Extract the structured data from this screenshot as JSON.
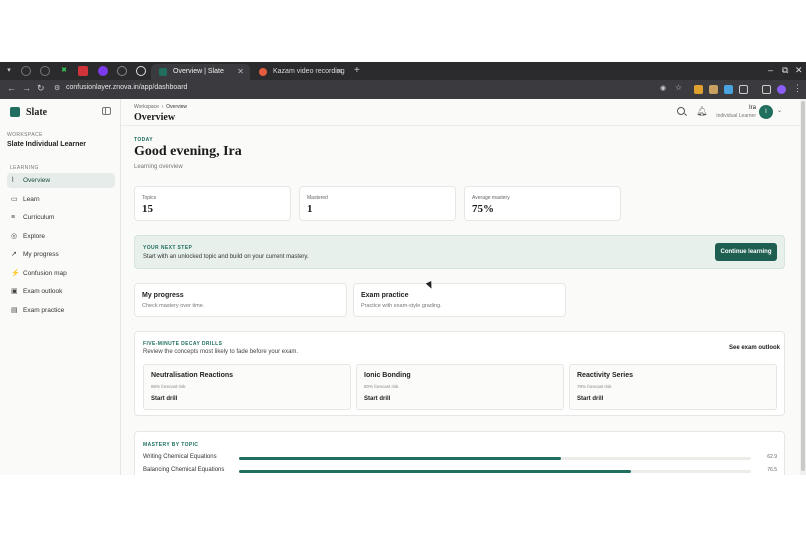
{
  "browser": {
    "tabs": [
      {
        "title": "Overview | Slate",
        "active": true
      },
      {
        "title": "Kazam video recording",
        "active": false
      }
    ],
    "url": "confusionlayer.znova.in/app/dashboard"
  },
  "sidebar": {
    "brand": "Slate",
    "workspace_label": "WORKSPACE",
    "workspace_name": "Slate Individual Learner",
    "section_label": "LEARNING",
    "items": [
      {
        "label": "Overview",
        "icon": "chart-icon",
        "active": true
      },
      {
        "label": "Learn",
        "icon": "book-icon",
        "active": false
      },
      {
        "label": "Curriculum",
        "icon": "layers-icon",
        "active": false
      },
      {
        "label": "Explore",
        "icon": "compass-icon",
        "active": false
      },
      {
        "label": "My progress",
        "icon": "trend-icon",
        "active": false
      },
      {
        "label": "Confusion map",
        "icon": "map-icon",
        "active": false
      },
      {
        "label": "Exam outlook",
        "icon": "calendar-icon",
        "active": false
      },
      {
        "label": "Exam practice",
        "icon": "clipboard-icon",
        "active": false
      }
    ]
  },
  "header": {
    "breadcrumb_root": "Workspace",
    "breadcrumb_current": "Overview",
    "title": "Overview",
    "user_name": "Ira",
    "user_role": "Individual Learner",
    "avatar_initial": "I"
  },
  "main": {
    "today_label": "TODAY",
    "greeting": "Good evening, Ira",
    "subtitle": "Learning overview",
    "stats": [
      {
        "label": "Topics",
        "value": "15"
      },
      {
        "label": "Mastered",
        "value": "1"
      },
      {
        "label": "Average mastery",
        "value": "75%"
      }
    ],
    "next_step": {
      "label": "YOUR NEXT STEP",
      "text": "Start with an unlocked topic and build on your current mastery.",
      "button": "Continue learning"
    },
    "cards": [
      {
        "title": "My progress",
        "subtitle": "Check mastery over time."
      },
      {
        "title": "Exam practice",
        "subtitle": "Practice with exam-style grading."
      }
    ],
    "drills": {
      "label": "FIVE-MINUTE DECAY DRILLS",
      "text": "Review the concepts most likely to fade before your exam.",
      "link": "See exam outlook",
      "items": [
        {
          "name": "Neutralisation Reactions",
          "risk": "86% forecast risk",
          "action": "Start drill"
        },
        {
          "name": "Ionic Bonding",
          "risk": "80% forecast risk",
          "action": "Start drill"
        },
        {
          "name": "Reactivity Series",
          "risk": "79% forecast risk",
          "action": "Start drill"
        }
      ]
    },
    "mastery": {
      "label": "MASTERY BY TOPIC",
      "rows": [
        {
          "topic": "Writing Chemical Equations",
          "value": 62.9
        },
        {
          "topic": "Balancing Chemical Equations",
          "value": 76.5
        }
      ]
    }
  },
  "colors": {
    "accent": "#1f6e5e",
    "button": "#1f5f52",
    "banner": "#e8f0ec"
  }
}
